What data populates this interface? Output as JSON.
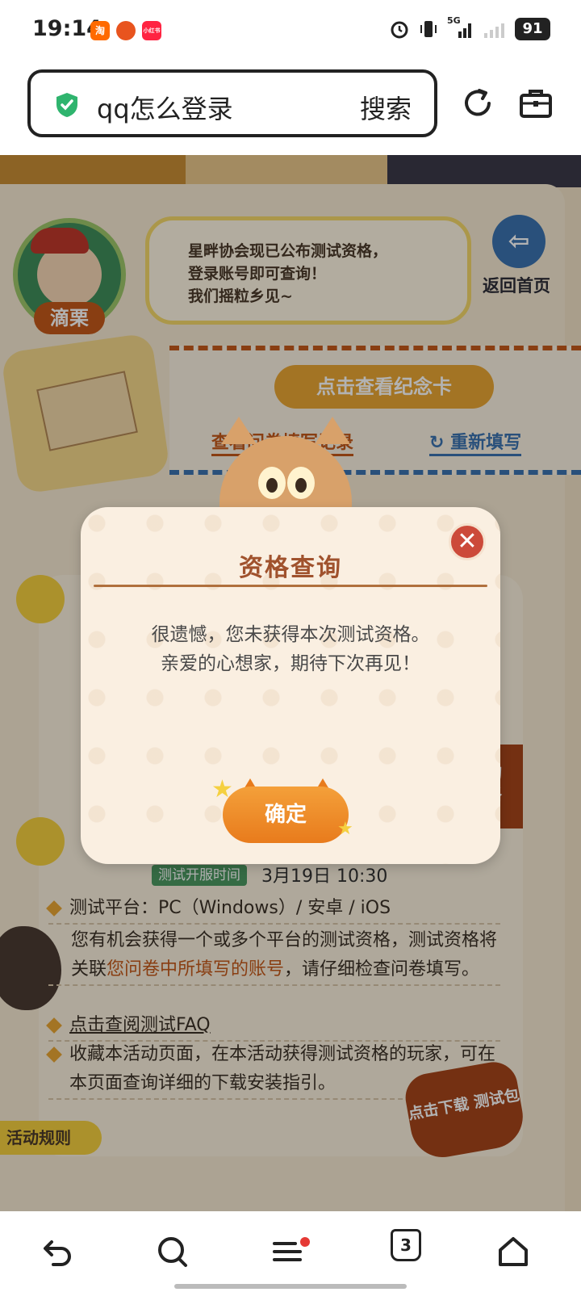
{
  "status_bar": {
    "time": "19:14",
    "app_icons": [
      {
        "label": "淘",
        "color": "#ff6a00"
      },
      {
        "label": "",
        "color": "#e8541e"
      },
      {
        "label": "小红书",
        "color": "#ff2442"
      }
    ],
    "network": "5G",
    "battery": "91"
  },
  "search": {
    "query": "qq怎么登录",
    "button_label": "搜索"
  },
  "page": {
    "avatar_name": "滴栗",
    "speech_lines": [
      "星畔协会现已公布测试资格，",
      "登录账号即可查询！",
      "我们摇粒乡见~"
    ],
    "home_label": "返回首页",
    "view_card_label": "点击查看纪念卡",
    "record_link": "查看问卷填写记录",
    "refill_link": "重新填写",
    "test_open_badge": "测试开服时间",
    "test_open_value": "3月19日  10:30",
    "rules": {
      "platform": "测试平台：PC（Windows）/ 安卓 / iOS",
      "qual_part1": "您有机会获得一个或多个平台的测试资格，测试资格将关联",
      "qual_highlight": "您问卷中所填写的账号",
      "qual_part2": "，请仔细检查问卷填写。",
      "faq_link": "点击查阅测试FAQ",
      "bookmark": "收藏本活动页面，在本活动获得测试资格的玩家，可在本页面查询详细的下载安装指引。"
    },
    "download_badge": "点击下载 测试包",
    "activity_rules_tab": "活动规则",
    "right_badge": "询 格"
  },
  "modal": {
    "title": "资格查询",
    "message_line1": "很遗憾，您未获得本次测试资格。",
    "message_line2": "亲爱的心想家，期待下次再见！",
    "confirm_label": "确定",
    "close_glyph": "✕"
  },
  "bottom_nav": {
    "tab_count": "3",
    "items": [
      "back",
      "search",
      "menu",
      "tabs",
      "home"
    ]
  },
  "colors": {
    "modal_bg": "#faefe1",
    "title_color": "#a0522d",
    "confirm_orange": "#e87b1c",
    "close_red": "#cc4a3a"
  }
}
